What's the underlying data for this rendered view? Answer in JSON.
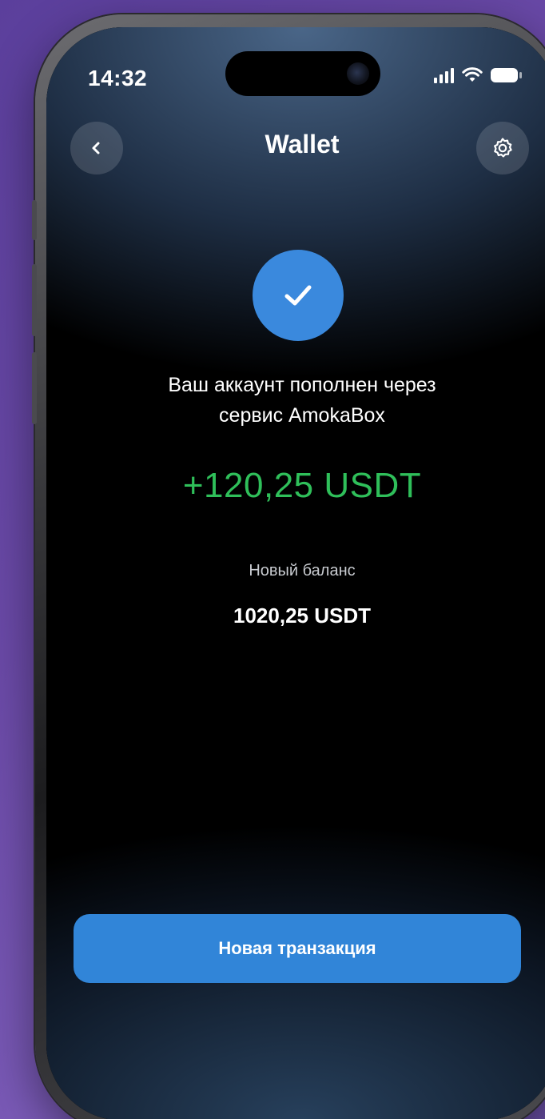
{
  "status_bar": {
    "time": "14:32",
    "signal_icon": "cellular-signal-icon",
    "wifi_icon": "wifi-icon",
    "battery_icon": "battery-icon"
  },
  "nav": {
    "title": "Wallet",
    "back_icon": "chevron-left-icon",
    "settings_icon": "gear-icon"
  },
  "success": {
    "icon": "checkmark-icon",
    "message_line1": "Ваш аккаунт пополнен через",
    "message_line2": "сервис AmokaBox",
    "amount": "+120,25 USDT"
  },
  "balance": {
    "label": "Новый баланс",
    "value": "1020,25 USDT"
  },
  "actions": {
    "new_transaction_label": "Новая транзакция"
  },
  "colors": {
    "accent": "#3185d8",
    "success_check_bg": "#3a89dd",
    "amount_green": "#2fbf5a",
    "background_top": "#4a6688",
    "background_base": "#000000",
    "backdrop_purple": "#6b4aa8"
  }
}
